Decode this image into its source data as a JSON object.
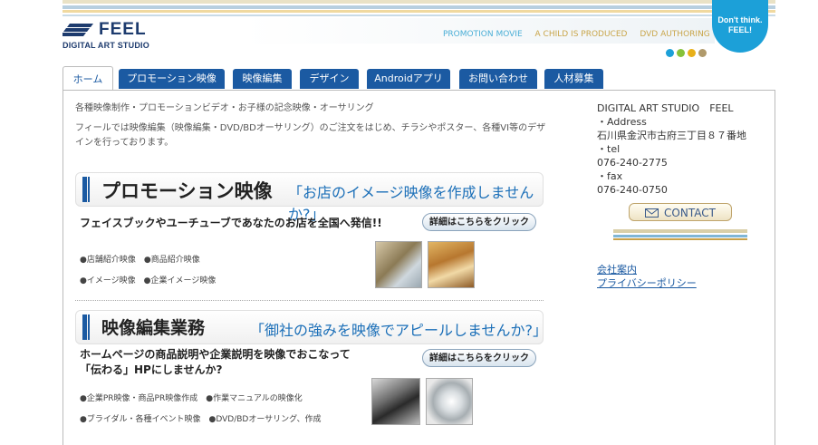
{
  "header": {
    "logo_text": "FEEL",
    "logo_subtitle": "DIGITAL ART STUDIO",
    "links": [
      {
        "label": "PROMOTION MOVIE",
        "color": "#4aaed6"
      },
      {
        "label": "A CHILD IS PRODUCED",
        "color": "#c9a64b"
      },
      {
        "label": "DVD AUTHORING",
        "color": "#c9a64b"
      }
    ],
    "badge_line1": "Don't think.",
    "badge_line2": "FEEL!",
    "dot_colors": [
      "#1ca0d8",
      "#86c23a",
      "#e8b019",
      "#b09a6b"
    ]
  },
  "nav": {
    "tabs": [
      "ホーム",
      "プロモーション映像",
      "映像編集",
      "デザイン",
      "Androidアプリ",
      "お問い合わせ",
      "人材募集"
    ]
  },
  "main": {
    "lead1": "各種映像制作・プロモーションビデオ・お子様の記念映像・オーサリング",
    "lead2": "フィールでは映像編集（映像編集・DVD/BDオーサリング）のご注文をはじめ、チラシやポスター、各種VI等のデザインを行っております。",
    "sections": [
      {
        "title": "プロモーション映像",
        "catch": "「お店のイメージ映像を作成しませんか?」",
        "subline": "フェイスブックやユーチューブであなたのお店を全国へ発信!!",
        "button": "詳細はこちらをクリック",
        "bullets": [
          "●店舗紹介映像　●商品紹介映像",
          "●イメージ映像　●企業イメージ映像"
        ]
      },
      {
        "title": "映像編集業務",
        "catch": "「御社の強みを映像でアピールしませんか?」",
        "subline1": "ホームページの商品説明や企業説明を映像でおこなって",
        "subline2": "「伝わる」HPにしませんか?",
        "button": "詳細はこちらをクリック",
        "bullets": [
          "●企業PR映像・商品PR映像作成　●作業マニュアルの映像化",
          "●ブライダル・各種イベント映像　●DVD/BDオーサリング、作成"
        ]
      }
    ]
  },
  "sidebar": {
    "company": "DIGITAL ART STUDIO　FEEL",
    "address_label": "・Address",
    "address": "石川県金沢市古府三丁目８７番地",
    "tel_label": "・tel",
    "tel": "076-240-2775",
    "fax_label": "・fax",
    "fax": "076-240-0750",
    "contact_button": "CONTACT",
    "links": [
      "会社案内",
      "プライバシーポリシー"
    ]
  }
}
